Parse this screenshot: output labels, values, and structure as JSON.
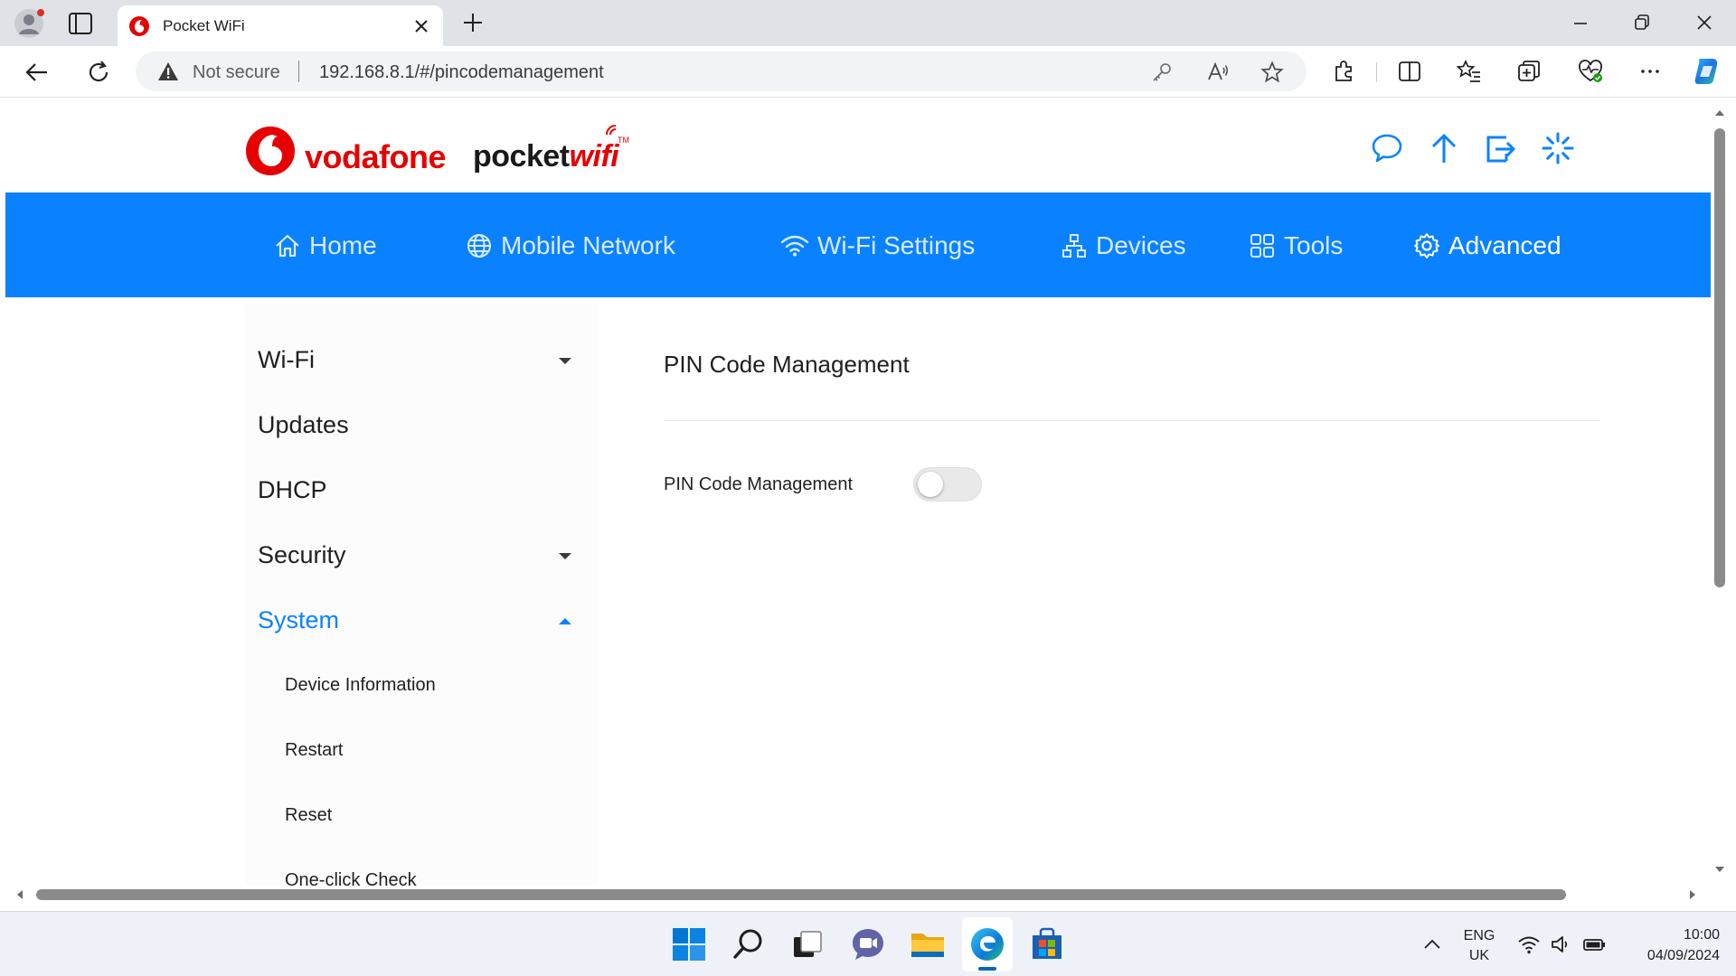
{
  "browser": {
    "tab_title": "Pocket WiFi",
    "not_secure_label": "Not secure",
    "url": "192.168.8.1/#/pincodemanagement"
  },
  "header": {
    "brand_name": "vodafone",
    "product_prefix": "pocket",
    "product_accent": "wifi",
    "trademark": "TM",
    "icons": [
      "message-icon",
      "upload-icon",
      "logout-icon",
      "loading-icon"
    ]
  },
  "main_nav": [
    {
      "label": "Home",
      "icon": "home-icon"
    },
    {
      "label": "Mobile Network",
      "icon": "globe-icon"
    },
    {
      "label": "Wi-Fi Settings",
      "icon": "wifi-icon"
    },
    {
      "label": "Devices",
      "icon": "devices-icon"
    },
    {
      "label": "Tools",
      "icon": "tools-icon"
    },
    {
      "label": "Advanced",
      "icon": "gear-icon",
      "active": true
    }
  ],
  "sidebar": {
    "items": [
      {
        "label": "Wi-Fi",
        "caret": "down"
      },
      {
        "label": "Updates"
      },
      {
        "label": "DHCP"
      },
      {
        "label": "Security",
        "caret": "down"
      },
      {
        "label": "System",
        "caret": "up",
        "open": true
      }
    ],
    "system_children": [
      "Device Information",
      "Restart",
      "Reset",
      "One-click Check"
    ]
  },
  "content": {
    "title": "PIN Code Management",
    "field_label": "PIN Code Management",
    "toggle_on": false
  },
  "taskbar": {
    "lang_primary": "ENG",
    "lang_secondary": "UK",
    "time": "10:00",
    "date": "04/09/2024"
  },
  "colors": {
    "nav_blue": "#0a82ff",
    "brand_red": "#e60000",
    "active_sidebar": "#0a82ff"
  }
}
